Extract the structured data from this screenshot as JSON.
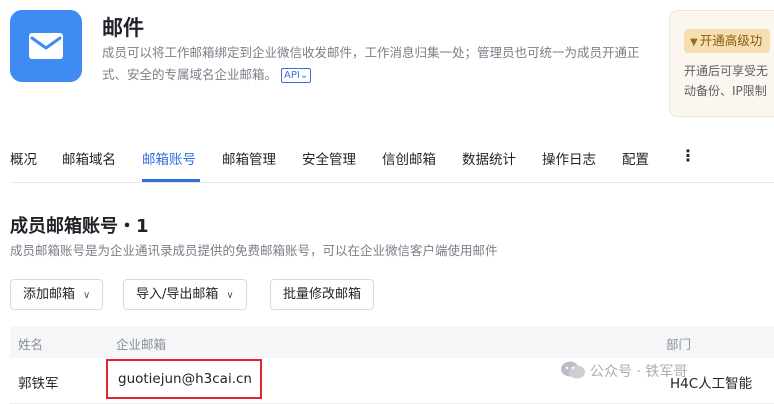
{
  "app": {
    "title": "邮件",
    "description": "成员可以将工作邮箱绑定到企业微信收发邮件，工作消息归集一处；管理员也可统一为成员开通正式、安全的专属域名企业邮箱。",
    "api_label": "API"
  },
  "upgrade": {
    "button_label": "开通高级功",
    "text_line1": "开通后可享受无",
    "text_line2": "动备份、IP限制"
  },
  "tabs": [
    {
      "label": "概况"
    },
    {
      "label": "邮箱域名"
    },
    {
      "label": "邮箱账号"
    },
    {
      "label": "邮箱管理"
    },
    {
      "label": "安全管理"
    },
    {
      "label": "信创邮箱"
    },
    {
      "label": "数据统计"
    },
    {
      "label": "操作日志"
    },
    {
      "label": "配置"
    }
  ],
  "active_tab": "邮箱账号",
  "more_label": "⋮",
  "section": {
    "title": "成员邮箱账号・1",
    "description": "成员邮箱账号是为企业通讯录成员提供的免费邮箱账号，可以在企业微信客户端使用邮件"
  },
  "toolbar": {
    "add_label": "添加邮箱",
    "import_export_label": "导入/导出邮箱",
    "batch_edit_label": "批量修改邮箱"
  },
  "table": {
    "headers": {
      "name": "姓名",
      "email": "企业邮箱",
      "dept": "部门"
    },
    "rows": [
      {
        "name": "郭铁军",
        "email": "guotiejun@h3cai.cn",
        "dept": "H4C人工智能"
      }
    ]
  },
  "watermark": {
    "text": "公众号 · 铁军哥"
  },
  "colors": {
    "accent": "#2f6fde",
    "app_icon": "#3e8cf3",
    "highlight_border": "#e0242c"
  }
}
